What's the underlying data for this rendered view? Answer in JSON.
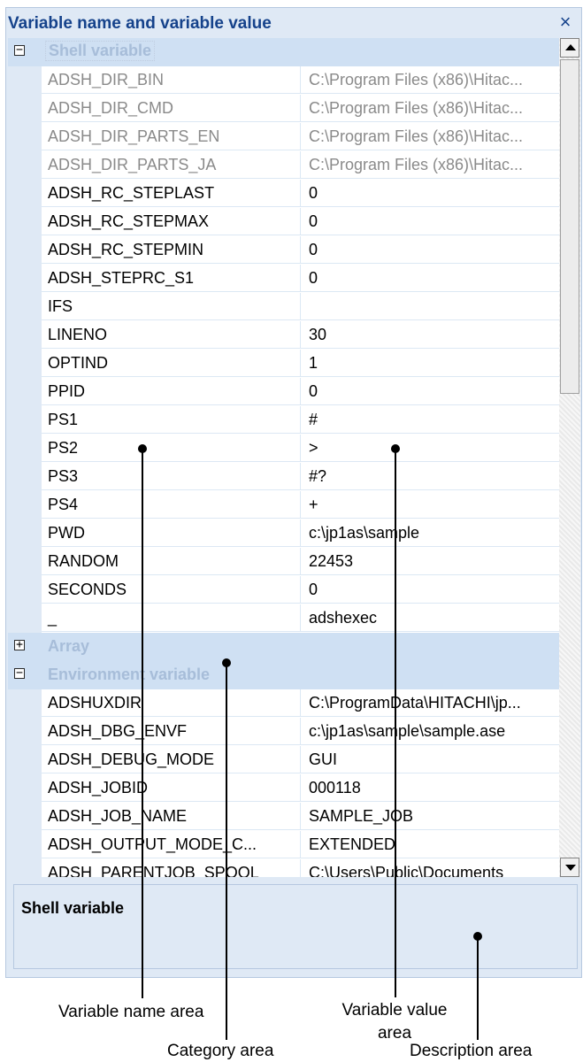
{
  "panel": {
    "title": "Variable name and variable value",
    "close_glyph": "×"
  },
  "grid": {
    "shell_category": {
      "label": "Shell variable",
      "toggle": "−"
    },
    "shell_rows": [
      {
        "name": "ADSH_DIR_BIN",
        "value": "C:\\Program Files (x86)\\Hitac...",
        "readonly": true
      },
      {
        "name": "ADSH_DIR_CMD",
        "value": "C:\\Program Files (x86)\\Hitac...",
        "readonly": true
      },
      {
        "name": "ADSH_DIR_PARTS_EN",
        "value": "C:\\Program Files (x86)\\Hitac...",
        "readonly": true
      },
      {
        "name": "ADSH_DIR_PARTS_JA",
        "value": "C:\\Program Files (x86)\\Hitac...",
        "readonly": true
      },
      {
        "name": "ADSH_RC_STEPLAST",
        "value": "0"
      },
      {
        "name": "ADSH_RC_STEPMAX",
        "value": "0"
      },
      {
        "name": "ADSH_RC_STEPMIN",
        "value": "0"
      },
      {
        "name": "ADSH_STEPRC_S1",
        "value": "0"
      },
      {
        "name": "IFS",
        "value": ""
      },
      {
        "name": "LINENO",
        "value": "30"
      },
      {
        "name": "OPTIND",
        "value": "1"
      },
      {
        "name": "PPID",
        "value": "0"
      },
      {
        "name": "PS1",
        "value": "#"
      },
      {
        "name": "PS2",
        "value": ">"
      },
      {
        "name": "PS3",
        "value": "#?"
      },
      {
        "name": "PS4",
        "value": "+"
      },
      {
        "name": "PWD",
        "value": "c:\\jp1as\\sample"
      },
      {
        "name": "RANDOM",
        "value": "22453"
      },
      {
        "name": "SECONDS",
        "value": "0"
      },
      {
        "name": "_",
        "value": "adshexec"
      }
    ],
    "array_category": {
      "label": "Array",
      "toggle": "+"
    },
    "env_category": {
      "label": "Environment variable",
      "toggle": "−"
    },
    "env_rows": [
      {
        "name": "ADSHUXDIR",
        "value": "C:\\ProgramData\\HITACHI\\jp..."
      },
      {
        "name": "ADSH_DBG_ENVF",
        "value": "c:\\jp1as\\sample\\sample.ase"
      },
      {
        "name": "ADSH_DEBUG_MODE",
        "value": "GUI"
      },
      {
        "name": "ADSH_JOBID",
        "value": "000118"
      },
      {
        "name": "ADSH_JOB_NAME",
        "value": "SAMPLE_JOB"
      },
      {
        "name": "ADSH_OUTPUT_MODE_C...",
        "value": "EXTENDED"
      },
      {
        "name": "ADSH_PARENTJOB_SPOOL",
        "value": "C:\\Users\\Public\\Documents"
      }
    ]
  },
  "description": {
    "title": "Shell variable"
  },
  "callouts": {
    "variable_name_area": "Variable name area",
    "variable_value_area_line1": "Variable value",
    "variable_value_area_line2": "area",
    "category_area": "Category area",
    "description_area": "Description area"
  }
}
